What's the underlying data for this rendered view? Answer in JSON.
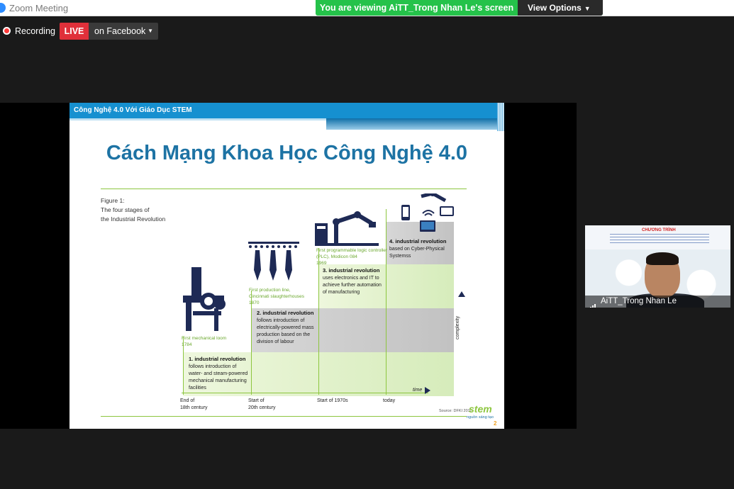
{
  "window": {
    "title": "Zoom Meeting"
  },
  "share_banner": {
    "viewing_text": "You are viewing AiTT_Trong Nhan Le's screen",
    "view_options_label": "View Options"
  },
  "recording": {
    "label": "Recording"
  },
  "live": {
    "badge": "LIVE",
    "target": "on Facebook"
  },
  "slide": {
    "header": "Công Nghệ 4.0 Với Giáo Dục STEM",
    "title": "Cách Mạng Khoa Học Công Nghệ 4.0",
    "figure_caption": [
      "Figure 1:",
      "The four stages of",
      "the Industrial Revolution"
    ],
    "stages": [
      {
        "title": "1. industrial revolution",
        "lines": [
          "follows introduction of",
          "water- and steam-powered",
          "mechanical manufacturing",
          "facilities"
        ]
      },
      {
        "title": "2. industrial revolution",
        "lines": [
          "follows introduction of",
          "electrically-powered mass",
          "production based on the",
          "division of labour"
        ]
      },
      {
        "title": "3. industrial revolution",
        "lines": [
          "uses electronics and IT to",
          "achieve further automation",
          "of manufacturing"
        ]
      },
      {
        "title": "4. industrial revolution",
        "lines": [
          "based on Cyber-Physical",
          "Systemss"
        ]
      }
    ],
    "events": [
      {
        "lines": [
          "First mechanical loom",
          "1784"
        ]
      },
      {
        "lines": [
          "First production line,",
          "Cincinnati slaughterhouses",
          "1870"
        ]
      },
      {
        "lines": [
          "First programmable logic controller",
          "(PLC), Modicon 084",
          "1969"
        ]
      }
    ],
    "eras": [
      {
        "lines": [
          "End of",
          "18th century"
        ]
      },
      {
        "lines": [
          "Start of",
          "20th century"
        ]
      },
      {
        "lines": [
          "Start of 1970s"
        ]
      },
      {
        "lines": [
          "today"
        ]
      }
    ],
    "time_label": "time",
    "complexity_label": "complexity",
    "source": "Source: DFKI 2011",
    "logo": "stem",
    "logo_tagline": "nguồn sáng tạo",
    "page_number": "2"
  },
  "video": {
    "participant_name": "AiTT_Trong Nhan Le",
    "banner_title": "CHƯƠNG TRÌNH"
  },
  "colors": {
    "accent": "#2d8cff",
    "banner_green": "#25c24a",
    "live_red": "#e0303a",
    "slide_blue": "#1690d0",
    "lime": "#8dc63f"
  }
}
